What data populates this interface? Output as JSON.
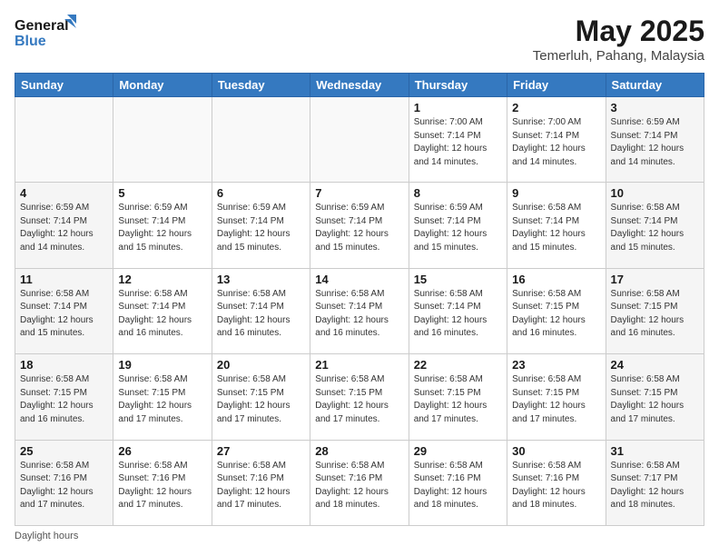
{
  "header": {
    "logo_line1": "General",
    "logo_line2": "Blue",
    "title": "May 2025",
    "subtitle": "Temerluh, Pahang, Malaysia"
  },
  "days_of_week": [
    "Sunday",
    "Monday",
    "Tuesday",
    "Wednesday",
    "Thursday",
    "Friday",
    "Saturday"
  ],
  "weeks": [
    [
      {
        "day": "",
        "info": ""
      },
      {
        "day": "",
        "info": ""
      },
      {
        "day": "",
        "info": ""
      },
      {
        "day": "",
        "info": ""
      },
      {
        "day": "1",
        "info": "Sunrise: 7:00 AM\nSunset: 7:14 PM\nDaylight: 12 hours\nand 14 minutes."
      },
      {
        "day": "2",
        "info": "Sunrise: 7:00 AM\nSunset: 7:14 PM\nDaylight: 12 hours\nand 14 minutes."
      },
      {
        "day": "3",
        "info": "Sunrise: 6:59 AM\nSunset: 7:14 PM\nDaylight: 12 hours\nand 14 minutes."
      }
    ],
    [
      {
        "day": "4",
        "info": "Sunrise: 6:59 AM\nSunset: 7:14 PM\nDaylight: 12 hours\nand 14 minutes."
      },
      {
        "day": "5",
        "info": "Sunrise: 6:59 AM\nSunset: 7:14 PM\nDaylight: 12 hours\nand 15 minutes."
      },
      {
        "day": "6",
        "info": "Sunrise: 6:59 AM\nSunset: 7:14 PM\nDaylight: 12 hours\nand 15 minutes."
      },
      {
        "day": "7",
        "info": "Sunrise: 6:59 AM\nSunset: 7:14 PM\nDaylight: 12 hours\nand 15 minutes."
      },
      {
        "day": "8",
        "info": "Sunrise: 6:59 AM\nSunset: 7:14 PM\nDaylight: 12 hours\nand 15 minutes."
      },
      {
        "day": "9",
        "info": "Sunrise: 6:58 AM\nSunset: 7:14 PM\nDaylight: 12 hours\nand 15 minutes."
      },
      {
        "day": "10",
        "info": "Sunrise: 6:58 AM\nSunset: 7:14 PM\nDaylight: 12 hours\nand 15 minutes."
      }
    ],
    [
      {
        "day": "11",
        "info": "Sunrise: 6:58 AM\nSunset: 7:14 PM\nDaylight: 12 hours\nand 15 minutes."
      },
      {
        "day": "12",
        "info": "Sunrise: 6:58 AM\nSunset: 7:14 PM\nDaylight: 12 hours\nand 16 minutes."
      },
      {
        "day": "13",
        "info": "Sunrise: 6:58 AM\nSunset: 7:14 PM\nDaylight: 12 hours\nand 16 minutes."
      },
      {
        "day": "14",
        "info": "Sunrise: 6:58 AM\nSunset: 7:14 PM\nDaylight: 12 hours\nand 16 minutes."
      },
      {
        "day": "15",
        "info": "Sunrise: 6:58 AM\nSunset: 7:14 PM\nDaylight: 12 hours\nand 16 minutes."
      },
      {
        "day": "16",
        "info": "Sunrise: 6:58 AM\nSunset: 7:15 PM\nDaylight: 12 hours\nand 16 minutes."
      },
      {
        "day": "17",
        "info": "Sunrise: 6:58 AM\nSunset: 7:15 PM\nDaylight: 12 hours\nand 16 minutes."
      }
    ],
    [
      {
        "day": "18",
        "info": "Sunrise: 6:58 AM\nSunset: 7:15 PM\nDaylight: 12 hours\nand 16 minutes."
      },
      {
        "day": "19",
        "info": "Sunrise: 6:58 AM\nSunset: 7:15 PM\nDaylight: 12 hours\nand 17 minutes."
      },
      {
        "day": "20",
        "info": "Sunrise: 6:58 AM\nSunset: 7:15 PM\nDaylight: 12 hours\nand 17 minutes."
      },
      {
        "day": "21",
        "info": "Sunrise: 6:58 AM\nSunset: 7:15 PM\nDaylight: 12 hours\nand 17 minutes."
      },
      {
        "day": "22",
        "info": "Sunrise: 6:58 AM\nSunset: 7:15 PM\nDaylight: 12 hours\nand 17 minutes."
      },
      {
        "day": "23",
        "info": "Sunrise: 6:58 AM\nSunset: 7:15 PM\nDaylight: 12 hours\nand 17 minutes."
      },
      {
        "day": "24",
        "info": "Sunrise: 6:58 AM\nSunset: 7:15 PM\nDaylight: 12 hours\nand 17 minutes."
      }
    ],
    [
      {
        "day": "25",
        "info": "Sunrise: 6:58 AM\nSunset: 7:16 PM\nDaylight: 12 hours\nand 17 minutes."
      },
      {
        "day": "26",
        "info": "Sunrise: 6:58 AM\nSunset: 7:16 PM\nDaylight: 12 hours\nand 17 minutes."
      },
      {
        "day": "27",
        "info": "Sunrise: 6:58 AM\nSunset: 7:16 PM\nDaylight: 12 hours\nand 17 minutes."
      },
      {
        "day": "28",
        "info": "Sunrise: 6:58 AM\nSunset: 7:16 PM\nDaylight: 12 hours\nand 18 minutes."
      },
      {
        "day": "29",
        "info": "Sunrise: 6:58 AM\nSunset: 7:16 PM\nDaylight: 12 hours\nand 18 minutes."
      },
      {
        "day": "30",
        "info": "Sunrise: 6:58 AM\nSunset: 7:16 PM\nDaylight: 12 hours\nand 18 minutes."
      },
      {
        "day": "31",
        "info": "Sunrise: 6:58 AM\nSunset: 7:17 PM\nDaylight: 12 hours\nand 18 minutes."
      }
    ]
  ],
  "footer": "Daylight hours"
}
